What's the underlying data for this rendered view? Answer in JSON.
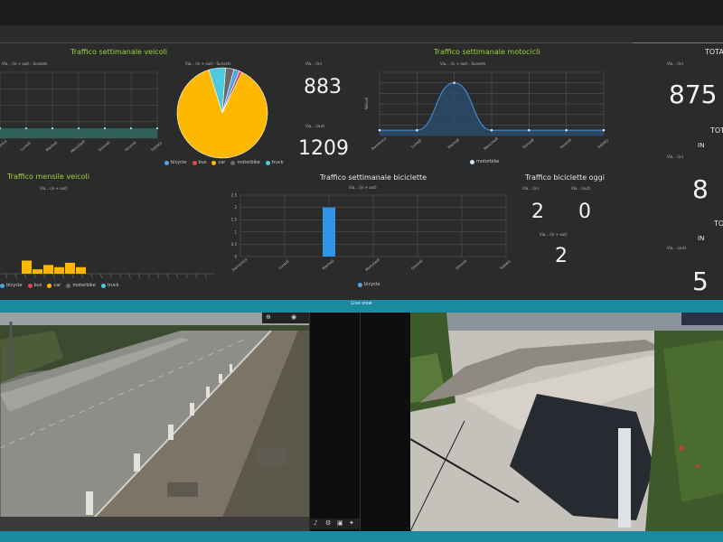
{
  "dashboard": {
    "weekly_vehicles": {
      "title": "Traffico settimanale veicoli",
      "subtitle": "Via... (in + out) - Sunsets",
      "days": [
        "Domenica",
        "Lunedì",
        "Martedì",
        "Mercoledì",
        "Giovedì",
        "Venerdì",
        "Sabato"
      ]
    },
    "pie": {
      "subtitle": "Via... (in + out) - Sunsets",
      "legend": [
        "bicycle",
        "bus",
        "car",
        "motorbike",
        "truck"
      ],
      "colors": {
        "bicycle": "#4fa3e0",
        "bus": "#e04848",
        "car": "#ffb800",
        "motorbike": "#6a6a6a",
        "truck": "#4fc9dc"
      }
    },
    "counters": {
      "in_label": "Via... (in)",
      "in_value": "883",
      "out_label": "Via... (out)",
      "out_value": "1209"
    },
    "weekly_motorbikes": {
      "title": "Traffico settimanale motocicli",
      "subtitle": "Via... (in + out) - Sunsets",
      "ylabel": "Veicoli",
      "legend": "motorbike"
    },
    "totals": {
      "title1": "TOTA",
      "value1": "875",
      "title2": "TOT",
      "in2": "IN",
      "value2": "8",
      "title3": "TOT",
      "in3": "IN",
      "value3": "5"
    },
    "monthly_vehicles": {
      "title": "Traffico mensile veicoli",
      "subtitle": "Via... (in + out)",
      "legend": [
        "bicycle",
        "bus",
        "car",
        "motorbike",
        "truck"
      ]
    },
    "weekly_bicycles": {
      "title": "Traffico settimanale biciclette",
      "subtitle": "Via... (in + out)",
      "legend": "bicycle"
    },
    "today_bicycles": {
      "title": "Traffico biciclette oggi",
      "in_label": "Via... (in)",
      "out_label": "Via... (out)",
      "in_value": "2",
      "out_value": "0",
      "total_label": "Via... (in + out)",
      "total_value": "2"
    }
  },
  "live_view": {
    "title": "Live view"
  },
  "chart_data": [
    {
      "type": "line",
      "title": "Traffico settimanale veicoli",
      "categories": [
        "Domenica",
        "Lunedì",
        "Martedì",
        "Mercoledì",
        "Giovedì",
        "Venerdì",
        "Sabato"
      ],
      "series": [
        {
          "name": "car",
          "values": [
            15,
            15,
            15,
            15,
            15,
            15,
            15
          ]
        }
      ],
      "ylim": [
        0,
        100
      ]
    },
    {
      "type": "pie",
      "labels": [
        "car",
        "truck",
        "motorbike",
        "bicycle",
        "bus"
      ],
      "values": [
        88,
        6,
        3,
        2,
        1
      ]
    },
    {
      "type": "area",
      "title": "Traffico settimanale motocicli",
      "categories": [
        "Domenica",
        "Lunedì",
        "Martedì",
        "Mercoledì",
        "Giovedì",
        "Venerdì",
        "Sabato"
      ],
      "series": [
        {
          "name": "motorbike",
          "values": [
            0.1,
            0.1,
            1.0,
            0.1,
            0.1,
            0.1,
            0.1
          ]
        }
      ],
      "ylim": [
        0,
        1.2
      ]
    },
    {
      "type": "bar",
      "title": "Traffico mensile veicoli",
      "series": [
        {
          "name": "car",
          "values": [
            3,
            1,
            2,
            1.5,
            2.5,
            1.5
          ]
        }
      ],
      "ylim": [
        0,
        10
      ]
    },
    {
      "type": "bar",
      "title": "Traffico settimanale biciclette",
      "categories": [
        "Domenica",
        "Lunedì",
        "Martedì",
        "Mercoledì",
        "Giovedì",
        "Venerdì",
        "Sabato"
      ],
      "series": [
        {
          "name": "bicycle",
          "values": [
            0,
            0,
            2,
            0,
            0,
            0,
            0
          ]
        }
      ],
      "ylim": [
        0,
        2.5
      ],
      "yticks": [
        "2.5",
        "2",
        "1.5",
        "1",
        "0.5",
        "0"
      ]
    }
  ]
}
